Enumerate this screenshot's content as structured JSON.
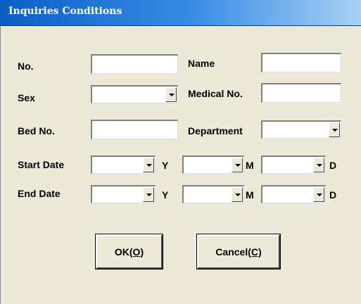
{
  "window": {
    "title": "Inquiries Conditions"
  },
  "form": {
    "no_label": "No.",
    "name_label": "Name",
    "sex_label": "Sex",
    "medical_no_label": "Medical No.",
    "bed_no_label": "Bed No.",
    "department_label": "Department",
    "start_date_label": "Start Date",
    "end_date_label": "End Date",
    "year_unit": "Y",
    "month_unit": "M",
    "day_unit": "D",
    "no_value": "",
    "name_value": "",
    "sex_value": "",
    "medical_no_value": "",
    "bed_no_value": "",
    "department_value": "",
    "start_year_value": "",
    "start_month_value": "",
    "start_day_value": "",
    "end_year_value": "",
    "end_month_value": "",
    "end_day_value": ""
  },
  "buttons": {
    "ok_label": "OK",
    "ok_mnemonic": "(O)",
    "cancel_label": "Cancel",
    "cancel_mnemonic": "(C)"
  }
}
